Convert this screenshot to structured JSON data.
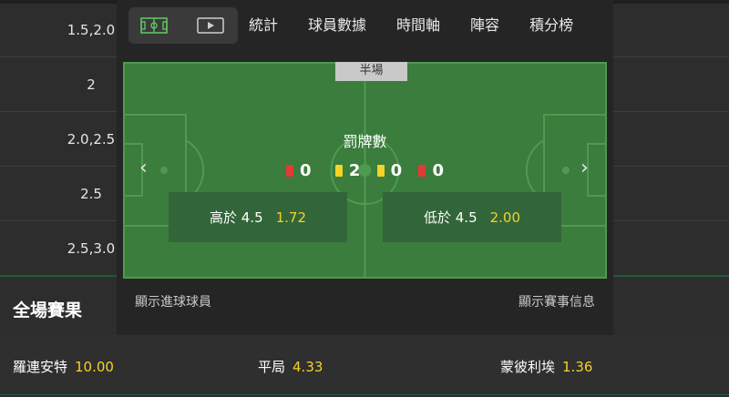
{
  "odds_list": [
    {
      "line": "1.5,2.0"
    },
    {
      "line": "2"
    },
    {
      "line": "2.0,2.5"
    },
    {
      "line": "2.5"
    },
    {
      "line": "2.5,3.0"
    }
  ],
  "full_time": {
    "title": "全場賽果",
    "outcomes": [
      {
        "label": "羅連安特",
        "odd": "10.00"
      },
      {
        "label": "平局",
        "odd": "4.33"
      },
      {
        "label": "蒙彼利埃",
        "odd": "1.36"
      }
    ]
  },
  "panel": {
    "icon_tabs": [
      {
        "icon": "pitch-icon"
      },
      {
        "icon": "play-icon"
      }
    ],
    "tabs": [
      "統計",
      "球員數據",
      "時間軸",
      "陣容",
      "積分榜"
    ],
    "pitch": {
      "period_badge": "半場",
      "stat_title": "罰牌數",
      "cards": [
        {
          "color": "#e53935",
          "count": "0"
        },
        {
          "color": "#f5d327",
          "count": "2"
        },
        {
          "color": "#f5d327",
          "count": "0"
        },
        {
          "color": "#e53935",
          "count": "0"
        }
      ],
      "bets": [
        {
          "label": "高於 4.5",
          "odd": "1.72"
        },
        {
          "label": "低於 4.5",
          "odd": "2.00"
        }
      ],
      "prev_arrow": "‹",
      "next_arrow": "›"
    },
    "footer": {
      "left_link": "顯示進球球員",
      "right_link": "顯示賽事信息"
    }
  },
  "colors": {
    "accent_yellow": "#f5d327",
    "pitch_green": "#3a7d3c",
    "red_card": "#e53935"
  }
}
